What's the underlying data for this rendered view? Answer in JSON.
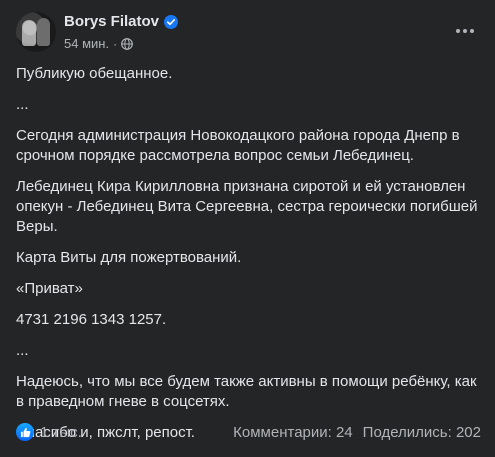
{
  "post": {
    "author": "Borys Filatov",
    "time": "54 мин.",
    "dot": "·",
    "paragraphs": [
      "Публикую обещанное.",
      "...",
      "Сегодня администрация Новокодацкого  района города Днепр в срочном порядке рассмотрела вопрос семьи Лебединец.",
      "Лебединец Кира Кирилловна признана сиротой и ей установлен опекун - Лебединец Вита Сергеевна, сестра героически погибшей Веры.",
      "Карта Виты для пожертвований.",
      "«Приват»",
      "4731 2196 1343 1257.",
      "...",
      "Надеюсь, что мы все будем также активны в помощи ребёнку, как в праведном гневе в соцсетях.",
      "Спасибо и, пжслт, репост."
    ]
  },
  "footer": {
    "reactions_count": "1 тыс.",
    "comments": "Комментарии: 24",
    "shares": "Поделились: 202"
  },
  "colors": {
    "card_bg": "#242526",
    "text": "#e4e6eb",
    "secondary": "#b0b3b8",
    "accent": "#1877f2"
  }
}
